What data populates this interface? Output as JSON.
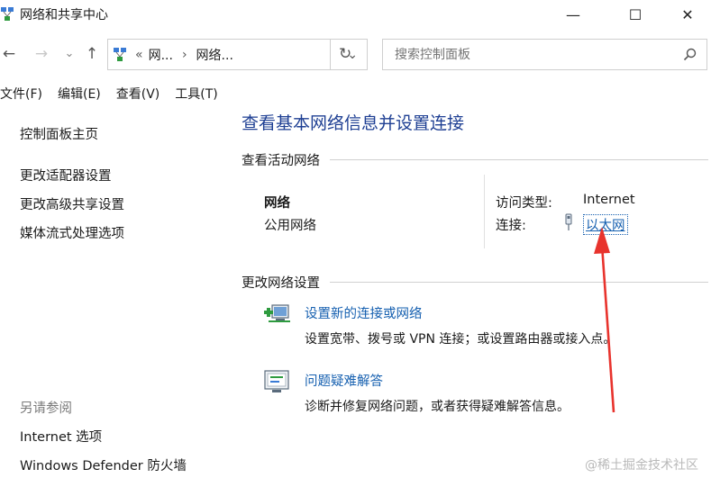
{
  "window": {
    "title": "网络和共享中心",
    "minimize": "—",
    "maximize": "☐",
    "close": "✕"
  },
  "nav": {
    "back": "←",
    "forward": "→",
    "dropdown": "⌄",
    "up": "↑",
    "refresh": "↻"
  },
  "address": {
    "prefix": "«",
    "crumb1": "网...",
    "arrow": "›",
    "crumb2": "网络...",
    "dropdown": "⌄"
  },
  "search": {
    "placeholder": "搜索控制面板"
  },
  "menu": {
    "file": "文件(F)",
    "edit": "编辑(E)",
    "view": "查看(V)",
    "tools": "工具(T)"
  },
  "sidebar": {
    "home": "控制面板主页",
    "links": [
      "更改适配器设置",
      "更改高级共享设置",
      "媒体流式处理选项"
    ],
    "see_also_label": "另请参阅",
    "see_also": [
      "Internet 选项",
      "Windows Defender 防火墙"
    ]
  },
  "main": {
    "title": "查看基本网络信息并设置连接",
    "active_section": "查看活动网络",
    "network_name": "网络",
    "network_type": "公用网络",
    "access_label": "访问类型:",
    "access_value": "Internet",
    "connection_label": "连接:",
    "connection_value": "以太网",
    "change_section": "更改网络设置",
    "tasks": [
      {
        "title": "设置新的连接或网络",
        "desc": "设置宽带、拨号或 VPN 连接；或设置路由器或接入点。"
      },
      {
        "title": "问题疑难解答",
        "desc": "诊断并修复网络问题，或者获得疑难解答信息。"
      }
    ]
  },
  "watermark": "@稀土掘金技术社区",
  "colors": {
    "link": "#1660b0",
    "heading": "#1e3f93",
    "arrow": "#e8332d"
  }
}
